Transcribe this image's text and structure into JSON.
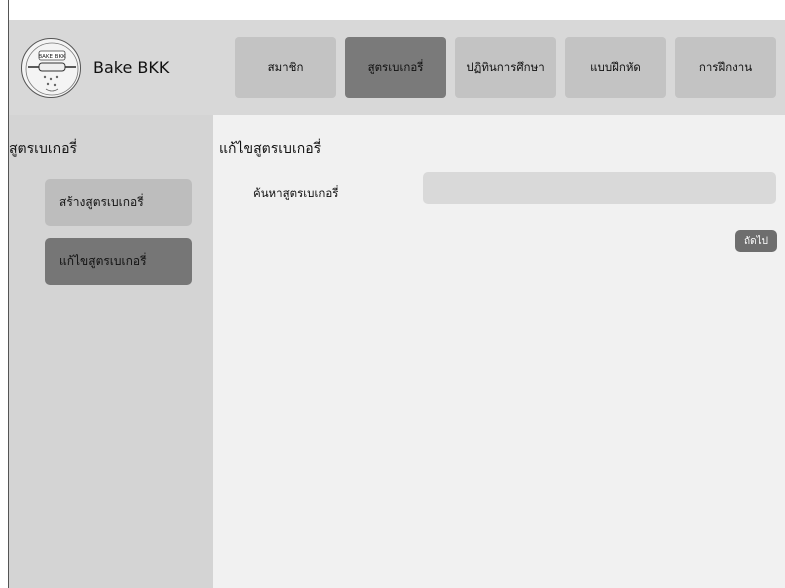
{
  "header": {
    "brand_name": "Bake BKK",
    "logo_text": "BAKE BKK",
    "logo_icon": "rolling-pin-logo"
  },
  "nav": {
    "items": [
      {
        "label": "สมาชิก",
        "active": false
      },
      {
        "label": "สูตรเบเกอรี่",
        "active": true
      },
      {
        "label": "ปฏิทินการศึกษา",
        "active": false
      },
      {
        "label": "แบบฝึกหัด",
        "active": false
      },
      {
        "label": "การฝึกงาน",
        "active": false
      }
    ]
  },
  "sidebar": {
    "title": "สูตรเบเกอรี่",
    "items": [
      {
        "label": "สร้างสูตรเบเกอรี่",
        "active": false
      },
      {
        "label": "แก้ไขสูตรเบเกอรี่",
        "active": true
      }
    ]
  },
  "main": {
    "title": "แก้ไขสูตรเบเกอรี่",
    "search_label": "ค้นหาสูตรเบเกอรี่",
    "search_value": "",
    "search_placeholder": "",
    "next_label": "ถัดไป"
  },
  "colors": {
    "header_bg": "#d8d8d8",
    "nav_button": "#c3c3c3",
    "nav_button_active": "#7a7a7a",
    "sidebar_bg": "#d4d4d4",
    "sidebar_button": "#bdbdbd",
    "sidebar_button_active": "#767676",
    "main_bg": "#f1f1f1",
    "input_bg": "#d9d9d9",
    "next_button": "#6e6e6e"
  }
}
